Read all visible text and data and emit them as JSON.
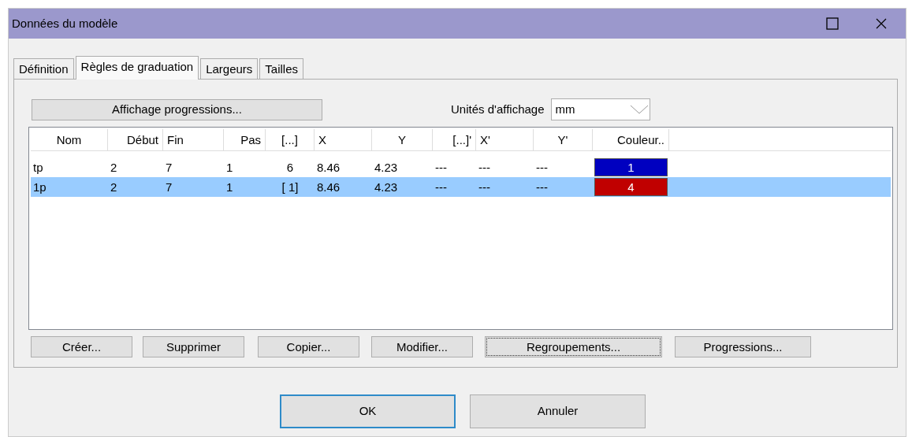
{
  "window": {
    "title": "Données du modèle"
  },
  "tabs": [
    {
      "label": "Définition",
      "selected": false
    },
    {
      "label": "Règles de graduation",
      "selected": true
    },
    {
      "label": "Largeurs",
      "selected": false
    },
    {
      "label": "Tailles",
      "selected": false
    }
  ],
  "display_button": "Affichage progressions...",
  "units": {
    "label": "Unités d'affichage",
    "value": "mm"
  },
  "table": {
    "columns": [
      {
        "label": "Nom"
      },
      {
        "label": "Début"
      },
      {
        "label": "Fin"
      },
      {
        "label": "Pas"
      },
      {
        "label": "[...]"
      },
      {
        "label": "X"
      },
      {
        "label": "Y"
      },
      {
        "label": "[...]'"
      },
      {
        "label": "X'"
      },
      {
        "label": "Y'"
      },
      {
        "label": "Couleur.."
      }
    ],
    "rows": [
      {
        "cells": [
          "tp",
          "2",
          "7",
          "1",
          "6",
          "8.46",
          "4.23",
          "---",
          "---",
          "---"
        ],
        "color_label": "1",
        "color": "#0000c0",
        "selected": false
      },
      {
        "cells": [
          "1p",
          "2",
          "7",
          "1",
          "[ 1]",
          "8.46",
          "4.23",
          "---",
          "---",
          "---"
        ],
        "color_label": "4",
        "color": "#c00000",
        "selected": true
      }
    ]
  },
  "actions": [
    {
      "label": "Créer...",
      "focused": false
    },
    {
      "label": "Supprimer",
      "focused": false
    },
    {
      "label": "Copier...",
      "focused": false
    },
    {
      "label": "Modifier...",
      "focused": false
    },
    {
      "label": "Regroupements...",
      "focused": true
    },
    {
      "label": "Progressions...",
      "focused": false
    }
  ],
  "dialog_buttons": [
    {
      "label": "OK",
      "default": true
    },
    {
      "label": "Annuler",
      "default": false
    }
  ]
}
